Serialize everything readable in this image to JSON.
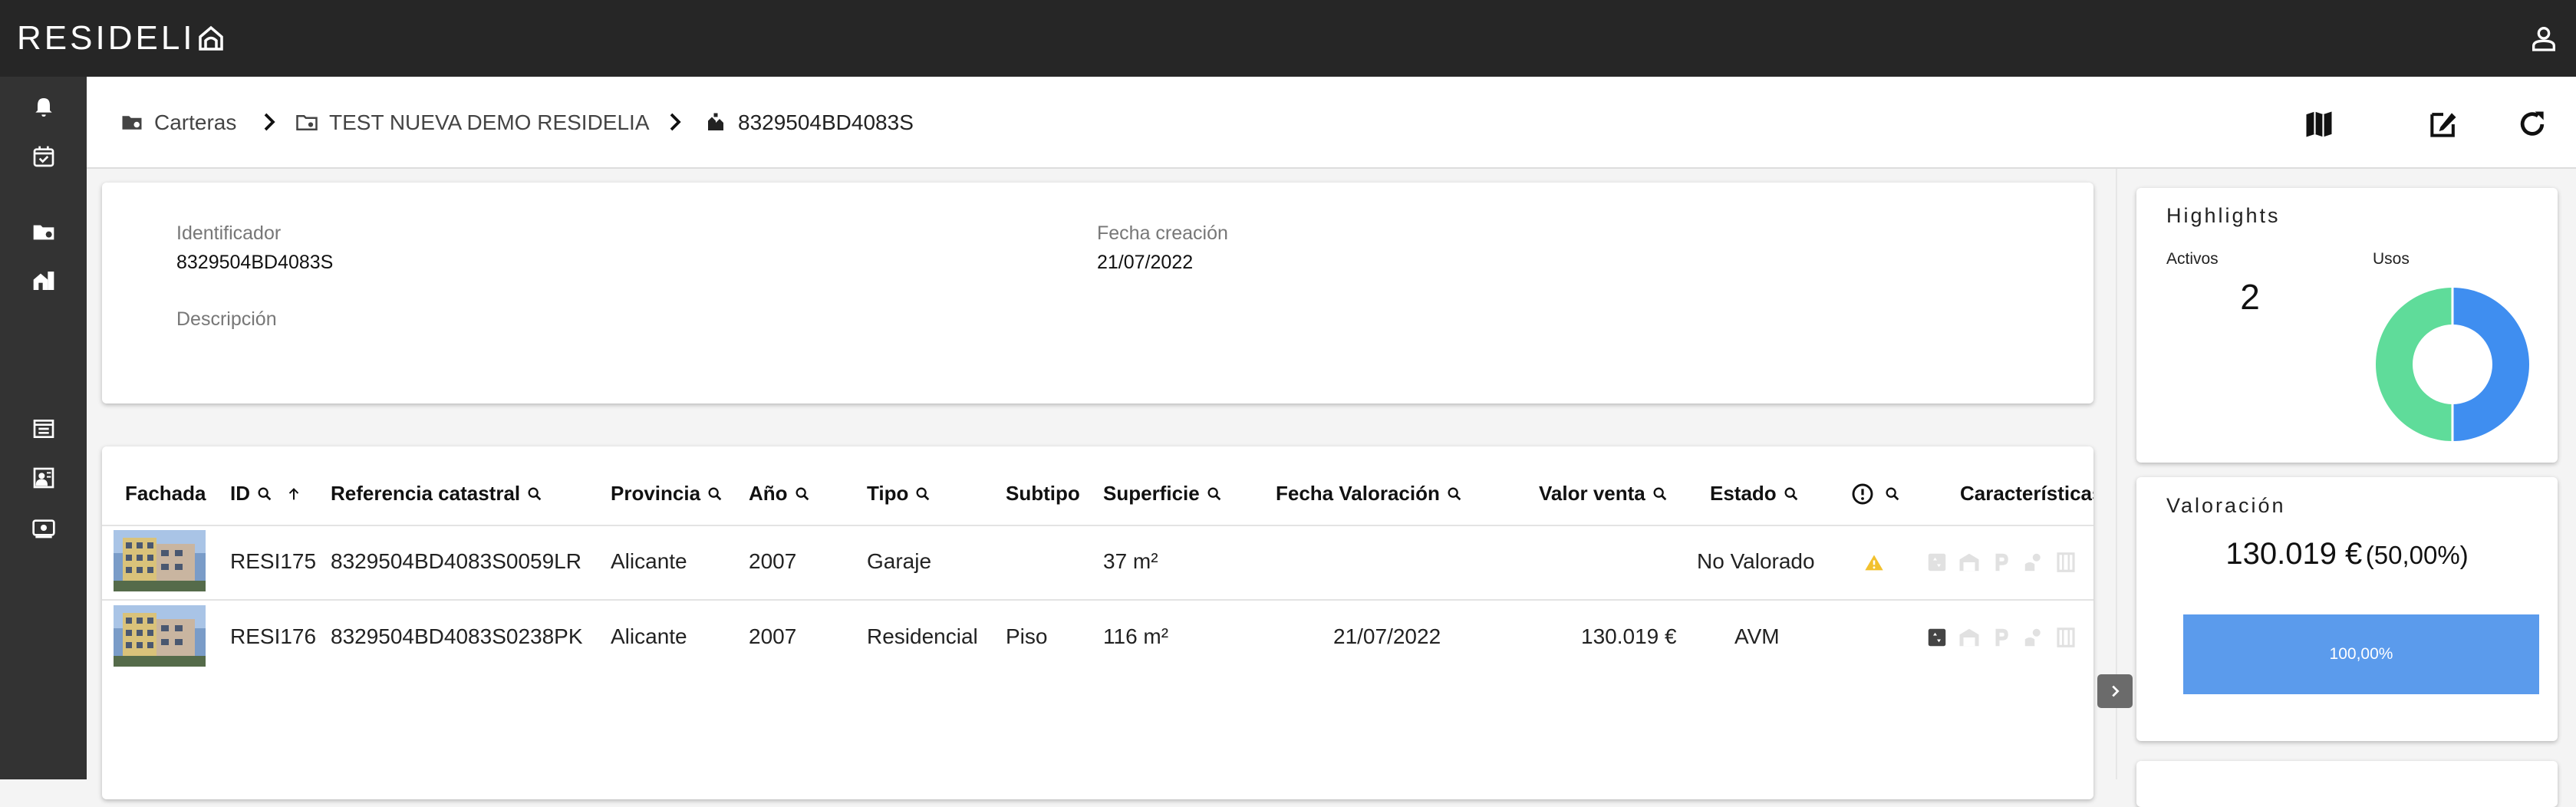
{
  "app": {
    "logo_text": "RESIDELI"
  },
  "breadcrumb": {
    "items": [
      {
        "label": "Carteras"
      },
      {
        "label": "TEST NUEVA DEMO RESIDELIA"
      },
      {
        "label": "8329504BD4083S"
      }
    ]
  },
  "details": {
    "id_label": "Identificador",
    "id_value": "8329504BD4083S",
    "date_label": "Fecha creación",
    "date_value": "21/07/2022",
    "desc_label": "Descripción"
  },
  "table": {
    "columns": [
      "Fachada",
      "ID",
      "Referencia catastral",
      "Provincia",
      "Año",
      "Tipo",
      "Subtipo",
      "Superficie",
      "Fecha Valoración",
      "Valor venta",
      "Estado",
      "Características"
    ],
    "rows": [
      {
        "id": "RESI175",
        "ref": "8329504BD4083S0059LR",
        "provincia": "Alicante",
        "anio": "2007",
        "tipo": "Garaje",
        "subtipo": "",
        "superficie": "37 m²",
        "fecha": "",
        "valor": "",
        "estado": "No Valorado",
        "warning": true
      },
      {
        "id": "RESI176",
        "ref": "8329504BD4083S0238PK",
        "provincia": "Alicante",
        "anio": "2007",
        "tipo": "Residencial",
        "subtipo": "Piso",
        "superficie": "116 m²",
        "fecha": "21/07/2022",
        "valor": "130.019 €",
        "estado": "AVM",
        "warning": false
      }
    ]
  },
  "highlights": {
    "title": "Highlights",
    "activos_label": "Activos",
    "activos_value": "2",
    "usos_label": "Usos",
    "usos_split": [
      0.5,
      0.5
    ],
    "colors": {
      "primary": "#3f8ef0",
      "secondary": "#5fdc9a"
    }
  },
  "valoracion": {
    "title": "Valoración",
    "amount": "130.019 €",
    "percent": "(50,00%)",
    "bar_label": "100,00%",
    "bar_fill": 1.0
  }
}
